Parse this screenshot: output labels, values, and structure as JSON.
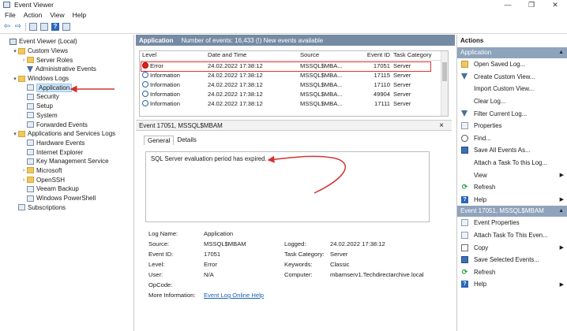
{
  "window": {
    "title": "Event Viewer",
    "controls": [
      "—",
      "❐",
      "✕"
    ]
  },
  "menu": [
    "File",
    "Action",
    "View",
    "Help"
  ],
  "tree": [
    {
      "label": "Event Viewer (Local)",
      "indent": 0,
      "exp": "",
      "icon": "viewer"
    },
    {
      "label": "Custom Views",
      "indent": 1,
      "exp": "▾",
      "icon": "folder"
    },
    {
      "label": "Server Roles",
      "indent": 2,
      "exp": "›",
      "icon": "folder"
    },
    {
      "label": "Administrative Events",
      "indent": 2,
      "exp": "",
      "icon": "filter"
    },
    {
      "label": "Windows Logs",
      "indent": 1,
      "exp": "▾",
      "icon": "folder"
    },
    {
      "label": "Application",
      "indent": 2,
      "exp": "",
      "icon": "log",
      "selected": true
    },
    {
      "label": "Security",
      "indent": 2,
      "exp": "",
      "icon": "log"
    },
    {
      "label": "Setup",
      "indent": 2,
      "exp": "",
      "icon": "log"
    },
    {
      "label": "System",
      "indent": 2,
      "exp": "",
      "icon": "log"
    },
    {
      "label": "Forwarded Events",
      "indent": 2,
      "exp": "",
      "icon": "log"
    },
    {
      "label": "Applications and Services Logs",
      "indent": 1,
      "exp": "▾",
      "icon": "folder"
    },
    {
      "label": "Hardware Events",
      "indent": 2,
      "exp": "",
      "icon": "log"
    },
    {
      "label": "Internet Explorer",
      "indent": 2,
      "exp": "",
      "icon": "log"
    },
    {
      "label": "Key Management Service",
      "indent": 2,
      "exp": "",
      "icon": "log"
    },
    {
      "label": "Microsoft",
      "indent": 2,
      "exp": "›",
      "icon": "folder"
    },
    {
      "label": "OpenSSH",
      "indent": 2,
      "exp": "›",
      "icon": "folder"
    },
    {
      "label": "Veeam Backup",
      "indent": 2,
      "exp": "",
      "icon": "log"
    },
    {
      "label": "Windows PowerShell",
      "indent": 2,
      "exp": "",
      "icon": "log"
    },
    {
      "label": "Subscriptions",
      "indent": 1,
      "exp": "",
      "icon": "log"
    }
  ],
  "log_header": {
    "name": "Application",
    "summary": "Number of events: 16,433 (!) New events available"
  },
  "table": {
    "columns": [
      "Level",
      "Date and Time",
      "Source",
      "Event ID",
      "Task Category"
    ],
    "rows": [
      {
        "level": "Error",
        "severity": "err",
        "date": "24.02.2022 17:38:12",
        "source": "MSSQL$MBA...",
        "id": "17051",
        "category": "Server"
      },
      {
        "level": "Information",
        "severity": "info",
        "date": "24.02.2022 17:38:12",
        "source": "MSSQL$MBA...",
        "id": "17115",
        "category": "Server"
      },
      {
        "level": "Information",
        "severity": "info",
        "date": "24.02.2022 17:38:12",
        "source": "MSSQL$MBA...",
        "id": "17110",
        "category": "Server"
      },
      {
        "level": "Information",
        "severity": "info",
        "date": "24.02.2022 17:38:12",
        "source": "MSSQL$MBA...",
        "id": "49904",
        "category": "Server"
      },
      {
        "level": "Information",
        "severity": "info",
        "date": "24.02.2022 17:38:12",
        "source": "MSSQL$MBA...",
        "id": "17111",
        "category": "Server"
      }
    ]
  },
  "detail": {
    "header": "Event 17051, MSSQL$MBAM",
    "close": "×",
    "tabs": [
      "General",
      "Details"
    ],
    "message": "SQL Server evaluation period has expired.",
    "labels": {
      "log_name": "Log Name:",
      "source": "Source:",
      "event_id": "Event ID:",
      "level": "Level:",
      "user": "User:",
      "opcode": "OpCode:",
      "more_info": "More Information:",
      "logged": "Logged:",
      "task_category": "Task Category:",
      "keywords": "Keywords:",
      "computer": "Computer:"
    },
    "values": {
      "log_name": "Application",
      "source": "MSSQL$MBAM",
      "event_id": "17051",
      "level": "Error",
      "user": "N/A",
      "more_info_link": "Event Log Online Help",
      "logged": "24.02.2022 17:38:12",
      "task_category": "Server",
      "keywords": "Classic",
      "computer": "mbamserv1.Techdirectarchive.local"
    }
  },
  "actions": {
    "title": "Actions",
    "section1": "Application",
    "items1": [
      {
        "label": "Open Saved Log...",
        "icon": "folder"
      },
      {
        "label": "Create Custom View...",
        "icon": "filter"
      },
      {
        "label": "Import Custom View...",
        "icon": "blank"
      },
      {
        "label": "Clear Log...",
        "icon": "blank"
      },
      {
        "label": "Filter Current Log...",
        "icon": "filter"
      },
      {
        "label": "Properties",
        "icon": "doc"
      },
      {
        "label": "Find...",
        "icon": "find"
      },
      {
        "label": "Save All Events As...",
        "icon": "save"
      },
      {
        "label": "Attach a Task To this Log...",
        "icon": "blank"
      },
      {
        "label": "View",
        "icon": "blank",
        "submenu": true
      },
      {
        "label": "Refresh",
        "icon": "refresh"
      },
      {
        "label": "Help",
        "icon": "help",
        "submenu": true
      }
    ],
    "section2": "Event 17051, MSSQL$MBAM",
    "items2": [
      {
        "label": "Event Properties",
        "icon": "doc"
      },
      {
        "label": "Attach Task To This Even...",
        "icon": "doc"
      },
      {
        "label": "Copy",
        "icon": "copy",
        "submenu": true
      },
      {
        "label": "Save Selected Events...",
        "icon": "save"
      },
      {
        "label": "Refresh",
        "icon": "refresh"
      },
      {
        "label": "Help",
        "icon": "help",
        "submenu": true
      }
    ]
  },
  "colors": {
    "accent_header": "#758aa3",
    "action_section": "#8fa3bc",
    "annotation": "#d33333",
    "selection": "#cce4f7"
  }
}
